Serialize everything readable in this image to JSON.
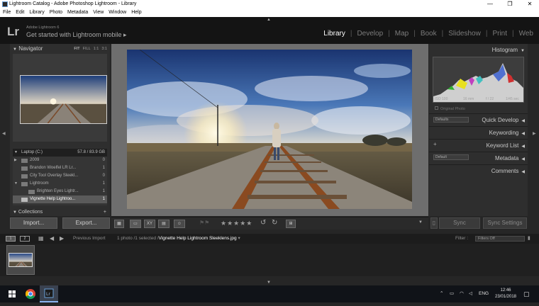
{
  "window": {
    "title": "Lightroom Catalog - Adobe Photoshop Lightroom - Library",
    "minimize": "—",
    "maximize": "❐",
    "close": "✕"
  },
  "menu": [
    "File",
    "Edit",
    "Library",
    "Photo",
    "Metadata",
    "View",
    "Window",
    "Help"
  ],
  "identity": {
    "logo": "Lr",
    "product": "Adobe Lightroom 6",
    "tagline": "Get started with Lightroom mobile ▸"
  },
  "modules": [
    "Library",
    "Develop",
    "Map",
    "Book",
    "Slideshow",
    "Print",
    "Web"
  ],
  "active_module": "Library",
  "navigator": {
    "label": "Navigator",
    "zoom_fit": "FIT",
    "zoom_fill": "FILL",
    "zoom_1to1": "1:1",
    "zoom_3to1": "3:1"
  },
  "folders": {
    "drive": {
      "name": "Laptop (C:)",
      "space": "57.8 / 83.9 GB"
    },
    "items": [
      {
        "name": "2009",
        "count": "0",
        "tri": "▶"
      },
      {
        "name": "Brandon Woelfel LR Lr...",
        "count": "1",
        "tri": ""
      },
      {
        "name": "City Tool Overlay Sleekl...",
        "count": "0",
        "tri": ""
      },
      {
        "name": "Lightroom",
        "count": "1",
        "tri": "▼"
      },
      {
        "name": "Brighten Eyes Lightr...",
        "count": "1",
        "tri": ""
      },
      {
        "name": "Vignette Help Lightroo...",
        "count": "1",
        "tri": ""
      }
    ]
  },
  "collections_label": "Collections",
  "left_buttons": {
    "import": "Import...",
    "export": "Export..."
  },
  "toolbar": {
    "stars": "★★★★★"
  },
  "right_panel": {
    "histogram": "Histogram",
    "iso": "ISO 100",
    "focal": "16 mm",
    "aperture": "f / 22",
    "shutter": "1/45 sec",
    "original_photo": "Original Photo",
    "quick_develop": "Quick Develop",
    "keywording": "Keywording",
    "keyword_list": "Keyword List",
    "metadata": "Metadata",
    "comments": "Comments",
    "preset_default": "Defaults",
    "metadata_default": "Default",
    "plus": "+"
  },
  "right_buttons": {
    "sync": "Sync",
    "sync_settings": "Sync Settings"
  },
  "filmstrip_bar": {
    "screen1": "1",
    "screen2": "2",
    "previous_import": "Previous Import",
    "count_text": "1 photo /1 selected /",
    "filename": "Vignette Help Lightroom Sleeklens.jpg",
    "filename_caret": "▾",
    "filter_label": "Filter :",
    "filter_value": "Filters Off"
  },
  "taskbar": {
    "lang": "ENG",
    "time": "12:46",
    "date": "23/01/2018"
  },
  "colors": {
    "accent": "#ffffff",
    "panel": "#2e2e2e",
    "background": "#262626"
  }
}
